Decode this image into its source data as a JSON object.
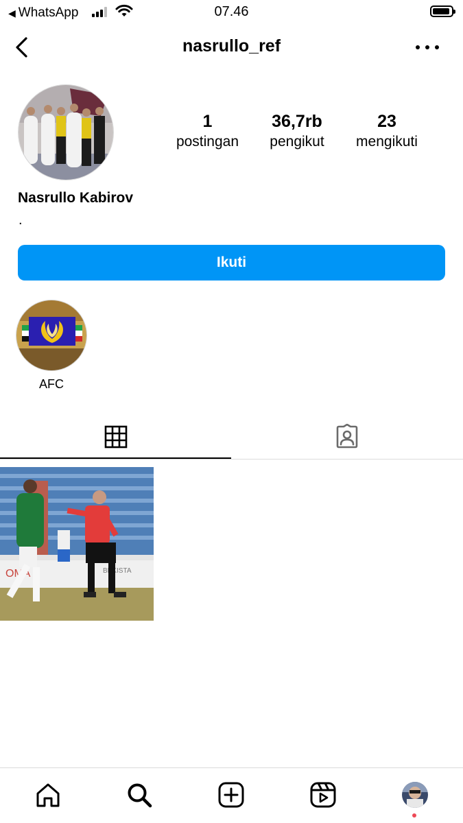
{
  "status_bar": {
    "back_app": "WhatsApp",
    "time": "07.46"
  },
  "header": {
    "username": "nasrullo_ref"
  },
  "profile": {
    "full_name": "Nasrullo Kabirov",
    "bio": ".",
    "stats": [
      {
        "value": "1",
        "label": "postingan"
      },
      {
        "value": "36,7rb",
        "label": "pengikut"
      },
      {
        "value": "23",
        "label": "mengikuti"
      }
    ],
    "follow_label": "Ikuti"
  },
  "highlights": [
    {
      "label": "AFC"
    }
  ],
  "tabs": [
    {
      "icon": "grid-icon",
      "active": true
    },
    {
      "icon": "tagged-icon",
      "active": false
    }
  ],
  "nav": [
    "home-icon",
    "search-icon",
    "create-icon",
    "reels-icon",
    "profile-avatar"
  ],
  "colors": {
    "accent": "#0095f6",
    "notification": "#ed4956"
  }
}
